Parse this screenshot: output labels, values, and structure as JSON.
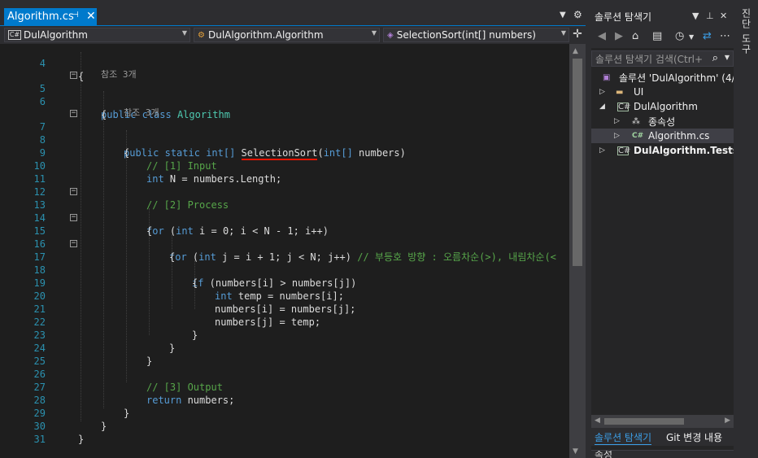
{
  "document_tab": {
    "title": "Algorithm.cs",
    "pin_icon": "pin-icon",
    "close_icon": "close-icon"
  },
  "navbar": {
    "project": "DulAlgorithm",
    "type": "DulAlgorithm.Algorithm",
    "member": "SelectionSort(int[] numbers)",
    "project_badge": "C#"
  },
  "code_lines": [
    {
      "n": "4",
      "t": "{"
    },
    {
      "n": "5",
      "t": ""
    },
    {
      "n": "6",
      "t": "{"
    },
    {
      "n": "7",
      "t": ""
    },
    {
      "n": "8",
      "t": "{"
    },
    {
      "n": "9",
      "t": "// [1] Input"
    },
    {
      "n": "10",
      "t": ""
    },
    {
      "n": "11",
      "t": ""
    },
    {
      "n": "12",
      "t": "// [2] Process"
    },
    {
      "n": "13",
      "t": ""
    },
    {
      "n": "14",
      "t": "{"
    },
    {
      "n": "15",
      "t": ""
    },
    {
      "n": "16",
      "t": "{"
    },
    {
      "n": "17",
      "t": ""
    },
    {
      "n": "18",
      "t": "{"
    },
    {
      "n": "19",
      "t": ""
    },
    {
      "n": "20",
      "t": "numbers[i] = numbers[j];"
    },
    {
      "n": "21",
      "t": "numbers[j] = temp;"
    },
    {
      "n": "22",
      "t": "}"
    },
    {
      "n": "23",
      "t": "}"
    },
    {
      "n": "24",
      "t": "}"
    },
    {
      "n": "25",
      "t": ""
    },
    {
      "n": "26",
      "t": "// [3] Output"
    },
    {
      "n": "27",
      "t": ""
    },
    {
      "n": "28",
      "t": "}"
    },
    {
      "n": "29",
      "t": "}"
    },
    {
      "n": "30",
      "t": "}"
    },
    {
      "n": "31",
      "t": ""
    }
  ],
  "code_tokens": {
    "public": "public",
    "class": "class",
    "class_name": "Algorithm",
    "static": "static",
    "int": "int",
    "int_arr": "int[]",
    "method_name": "SelectionSort",
    "paren_open": "(",
    "params": " numbers)",
    "n_decl": " N = numbers.Length;",
    "for": "for",
    "for1_rest": " i = 0; i < N - 1; i++)",
    "for2_rest": " j = i + 1; j < N; j++)",
    "for2_comment": "// 부등호 방향 : 오름차순(>), 내림차순(<",
    "if": "if",
    "if_cond": " (numbers[i] > numbers[j])",
    "temp_decl": " temp = numbers[i];",
    "return": "return",
    "return_rest": " numbers;",
    "paren_space": " ("
  },
  "codelens": {
    "class_refs": "참조 3개",
    "method_refs": "참조 3개"
  },
  "solution_explorer": {
    "title": "솔루션 탐색기",
    "search_placeholder": "솔루션 탐색기 검색(Ctrl+",
    "tree": [
      {
        "label": "솔루션 'DulAlgorithm' (4/",
        "icon": "solution-icon"
      },
      {
        "label": "UI",
        "icon": "folder-icon"
      },
      {
        "label": "DulAlgorithm",
        "icon": "csharp-project-icon"
      },
      {
        "label": "종속성",
        "icon": "dependencies-icon"
      },
      {
        "label": "Algorithm.cs",
        "icon": "csharp-file-icon"
      },
      {
        "label": "DulAlgorithm.Tests",
        "icon": "csharp-project-icon"
      }
    ],
    "bottom_tabs": {
      "active": "솔루션 탐색기",
      "other": "Git 변경 내용"
    },
    "next_panel_title": "속성"
  },
  "side_strip": {
    "tab": "진단 도구"
  },
  "colors": {
    "accent": "#007acc",
    "keyword": "#569cd6",
    "type": "#4ec9b0",
    "comment": "#57a64a",
    "line_number": "#2b91af",
    "error": "#e51400"
  }
}
